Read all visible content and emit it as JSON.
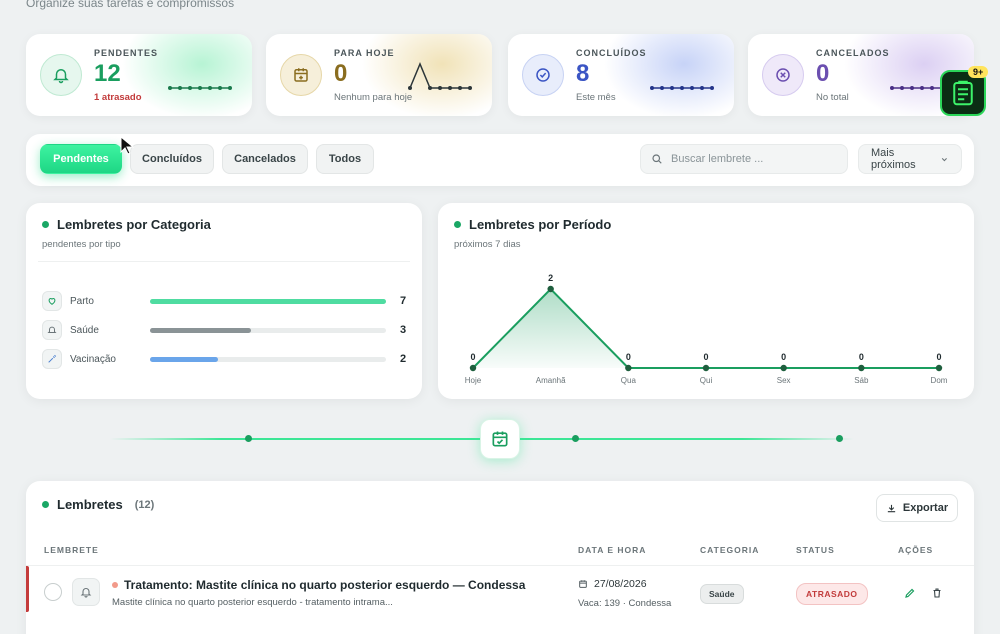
{
  "header": {
    "subtitle": "Organize suas tarefas e compromissos"
  },
  "stats": [
    {
      "label": "PENDENTES",
      "value": "12",
      "sub": "1 atrasado",
      "icon": "bell-icon",
      "color": "#1a9e5f",
      "sub_color": "#c23b3b"
    },
    {
      "label": "PARA HOJE",
      "value": "0",
      "sub": "Nenhum para hoje",
      "icon": "calendar-plus-icon",
      "color": "#8a6d1f"
    },
    {
      "label": "CONCLUÍDOS",
      "value": "8",
      "sub": "Este mês",
      "icon": "check-circle-icon",
      "color": "#3b55c4"
    },
    {
      "label": "CANCELADOS",
      "value": "0",
      "sub": "No total",
      "icon": "x-circle-icon",
      "color": "#6b4fb0"
    }
  ],
  "filters": {
    "tabs": [
      "Pendentes",
      "Concluídos",
      "Cancelados",
      "Todos"
    ],
    "active": "Pendentes",
    "search_placeholder": "Buscar lembrete ...",
    "sort_label": "Mais próximos"
  },
  "category_panel": {
    "title": "Lembretes por Categoria",
    "subtitle": "pendentes por tipo",
    "items": [
      {
        "name": "Parto",
        "value": 7,
        "color": "#4fdca1",
        "fraction": 1.0,
        "icon": "heart-icon"
      },
      {
        "name": "Saúde",
        "value": 3,
        "color": "#8a9396",
        "fraction": 0.43,
        "icon": "bell-icon"
      },
      {
        "name": "Vacinação",
        "value": 2,
        "color": "#6aa5ea",
        "fraction": 0.29,
        "icon": "syringe-icon"
      }
    ]
  },
  "period_panel": {
    "title": "Lembretes por Período",
    "subtitle": "próximos 7 dias"
  },
  "chart_data": {
    "type": "area",
    "categories": [
      "Hoje",
      "Amanhã",
      "Qua",
      "Qui",
      "Sex",
      "Sáb",
      "Dom"
    ],
    "values": [
      0,
      2,
      0,
      0,
      0,
      0,
      0
    ],
    "title": "Lembretes por Período",
    "ylim": [
      0,
      2
    ],
    "grid": false,
    "color": "#1a9e5f"
  },
  "list": {
    "title": "Lembretes",
    "count": "(12)",
    "export_label": "Exportar",
    "columns": [
      "LEMBRETE",
      "DATA E HORA",
      "CATEGORIA",
      "STATUS",
      "AÇÕES"
    ],
    "rows": [
      {
        "title": "Tratamento: Mastite clínica no quarto posterior esquerdo — Condessa",
        "desc": "Mastite clínica no quarto posterior esquerdo - tratamento intrama...",
        "date": "27/08/2026",
        "cow": "Vaca: 139 · Condessa",
        "category": "Saúde",
        "status": "ATRASADO"
      }
    ]
  },
  "app_badge": "9+"
}
